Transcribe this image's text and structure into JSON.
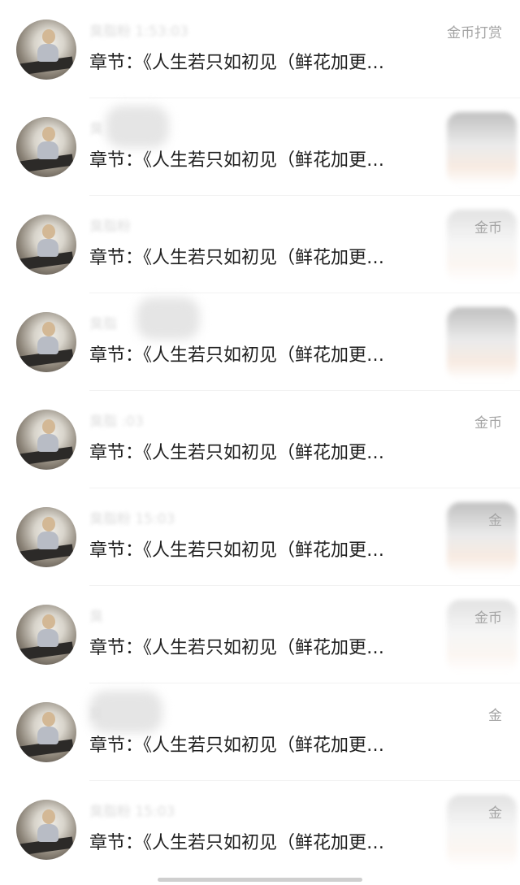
{
  "items": [
    {
      "name_blurred": "臭脂粉  1:53:03",
      "chapter": "章节：《人生若只如初见（鲜花加更…",
      "tip": "金币打赏"
    },
    {
      "name_blurred": "臭",
      "chapter": "章节：《人生若只如初见（鲜花加更…",
      "tip": ""
    },
    {
      "name_blurred": "臭脂粉",
      "chapter": "章节：《人生若只如初见（鲜花加更…",
      "tip": "金币"
    },
    {
      "name_blurred": "臭脂",
      "chapter": "章节：《人生若只如初见（鲜花加更…",
      "tip": ""
    },
    {
      "name_blurred": "臭脂  :03",
      "chapter": "章节：《人生若只如初见（鲜花加更…",
      "tip": "金币"
    },
    {
      "name_blurred": "臭脂粉  15:03",
      "chapter": "章节：《人生若只如初见（鲜花加更…",
      "tip": "金"
    },
    {
      "name_blurred": "臭",
      "chapter": "章节：《人生若只如初见（鲜花加更…",
      "tip": "金币"
    },
    {
      "name_blurred": "臭",
      "chapter": "章节：《人生若只如初见（鲜花加更…",
      "tip": "金"
    },
    {
      "name_blurred": "臭脂粉  15:03",
      "chapter": "章节：《人生若只如初见（鲜花加更…",
      "tip": "金"
    }
  ],
  "colors": {
    "text_primary": "#1f1f1f",
    "text_secondary": "#a3a3a3",
    "divider": "#f2f2f2",
    "background": "#ffffff"
  }
}
